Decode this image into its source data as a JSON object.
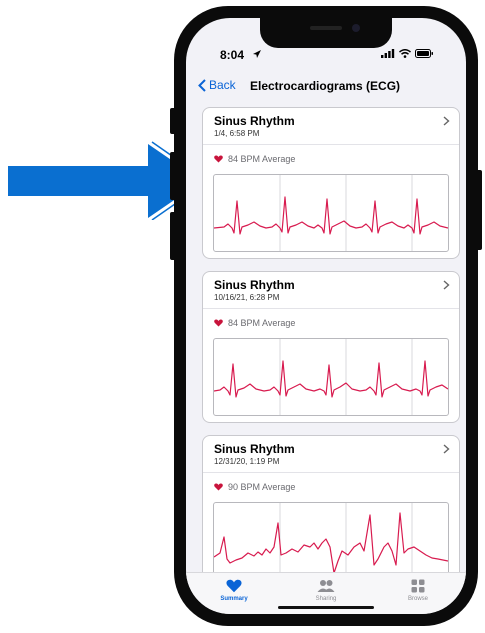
{
  "status_bar": {
    "time": "8:04"
  },
  "nav": {
    "back_label": "Back",
    "title": "Electrocardiograms (ECG)"
  },
  "recordings": [
    {
      "title": "Sinus Rhythm",
      "date": "1/4, 6:58 PM",
      "bpm_text": "84 BPM Average"
    },
    {
      "title": "Sinus Rhythm",
      "date": "10/16/21, 6:28 PM",
      "bpm_text": "84 BPM Average"
    },
    {
      "title": "Sinus Rhythm",
      "date": "12/31/20, 1:19 PM",
      "bpm_text": "90 BPM Average"
    }
  ],
  "tabs": [
    {
      "label": "Summary",
      "icon": "heart-icon",
      "active": true
    },
    {
      "label": "Sharing",
      "icon": "people-icon",
      "active": false
    },
    {
      "label": "Browse",
      "icon": "grid-icon",
      "active": false
    }
  ],
  "colors": {
    "accent": "#0a64d6",
    "ecg_trace": "#d81b4f",
    "heart": "#c8143c",
    "pointer_arrow": "#0a6fd0"
  }
}
